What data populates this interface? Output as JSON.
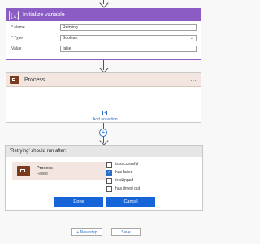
{
  "init_variable": {
    "icon_label": "{x}",
    "title": "Initialize variable",
    "more": "···",
    "fields": [
      {
        "label": "* Name",
        "value": "Retrying"
      },
      {
        "label": "* Type",
        "value": "Boolean"
      },
      {
        "label": "Value",
        "value": "false"
      }
    ]
  },
  "process_card": {
    "title": "Process",
    "more": "···",
    "add_action": "Add an action"
  },
  "run_after": {
    "header": "'Retrying' should run after:",
    "item_name": "Process",
    "item_status": "Failed",
    "options": [
      {
        "label": "is successful",
        "checked": false
      },
      {
        "label": "has failed",
        "checked": true
      },
      {
        "label": "is skipped",
        "checked": false
      },
      {
        "label": "has timed out",
        "checked": false
      }
    ],
    "done_label": "Done",
    "cancel_label": "Cancel"
  },
  "footer": {
    "new_step_label": "+ New step",
    "save_label": "Save"
  },
  "colors": {
    "variable_accent": "#8a5cc4",
    "scope_accent": "#7a3c1c",
    "primary": "#1565d8",
    "link": "#2b6fc8"
  }
}
